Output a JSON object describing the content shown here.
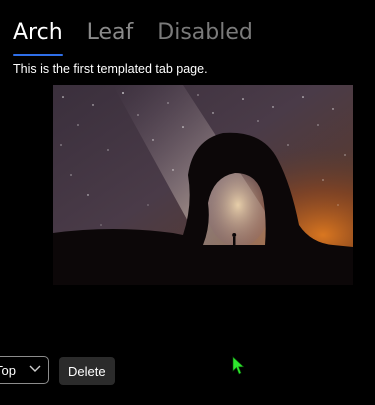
{
  "tabs": [
    {
      "label": "Arch",
      "state": "active"
    },
    {
      "label": "Leaf",
      "state": "inactive"
    },
    {
      "label": "Disabled",
      "state": "disabled"
    }
  ],
  "tab_page": {
    "text": "This is the first templated tab page.",
    "image": "night-sky-arch-photo"
  },
  "controls": {
    "position_select": {
      "value": "Top",
      "icon": "chevron-down-icon"
    },
    "delete_label": "Delete"
  },
  "colors": {
    "background": "#000000",
    "active_indicator": "#2f6fe8",
    "inactive_tab": "#8a8a8a",
    "button_bg": "#2b2b2b",
    "cursor": "#2ee82e"
  }
}
